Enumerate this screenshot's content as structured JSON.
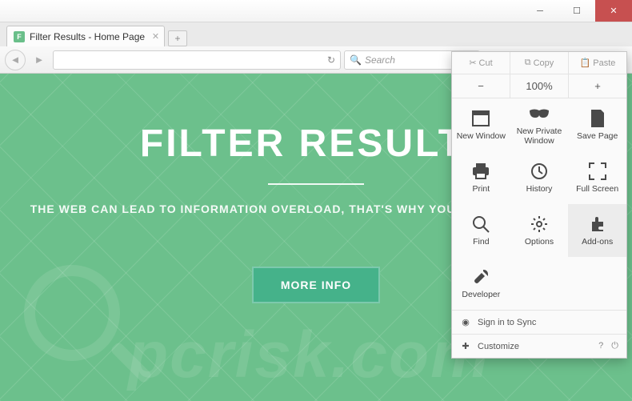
{
  "window": {
    "title": ""
  },
  "tab": {
    "title": "Filter Results - Home Page",
    "favicon_letter": "F"
  },
  "nav": {
    "search_placeholder": "Search"
  },
  "page": {
    "heading": "FILTER RESULTS",
    "subtitle": "THE WEB CAN LEAD TO INFORMATION OVERLOAD, THAT'S WHY YOU NEED FILTER RESULTS",
    "cta": "MORE INFO",
    "watermark": "pcrisk.com"
  },
  "menu": {
    "edit": {
      "cut": "Cut",
      "copy": "Copy",
      "paste": "Paste"
    },
    "zoom": {
      "minus": "−",
      "value": "100%",
      "plus": "+"
    },
    "items": [
      {
        "label": "New Window",
        "icon": "window"
      },
      {
        "label": "New Private Window",
        "icon": "mask"
      },
      {
        "label": "Save Page",
        "icon": "save"
      },
      {
        "label": "Print",
        "icon": "print"
      },
      {
        "label": "History",
        "icon": "history"
      },
      {
        "label": "Full Screen",
        "icon": "fullscreen"
      },
      {
        "label": "Find",
        "icon": "find"
      },
      {
        "label": "Options",
        "icon": "options"
      },
      {
        "label": "Add-ons",
        "icon": "addons",
        "highlight": true
      },
      {
        "label": "Developer",
        "icon": "developer"
      }
    ],
    "signin": "Sign in to Sync",
    "customize": "Customize"
  }
}
